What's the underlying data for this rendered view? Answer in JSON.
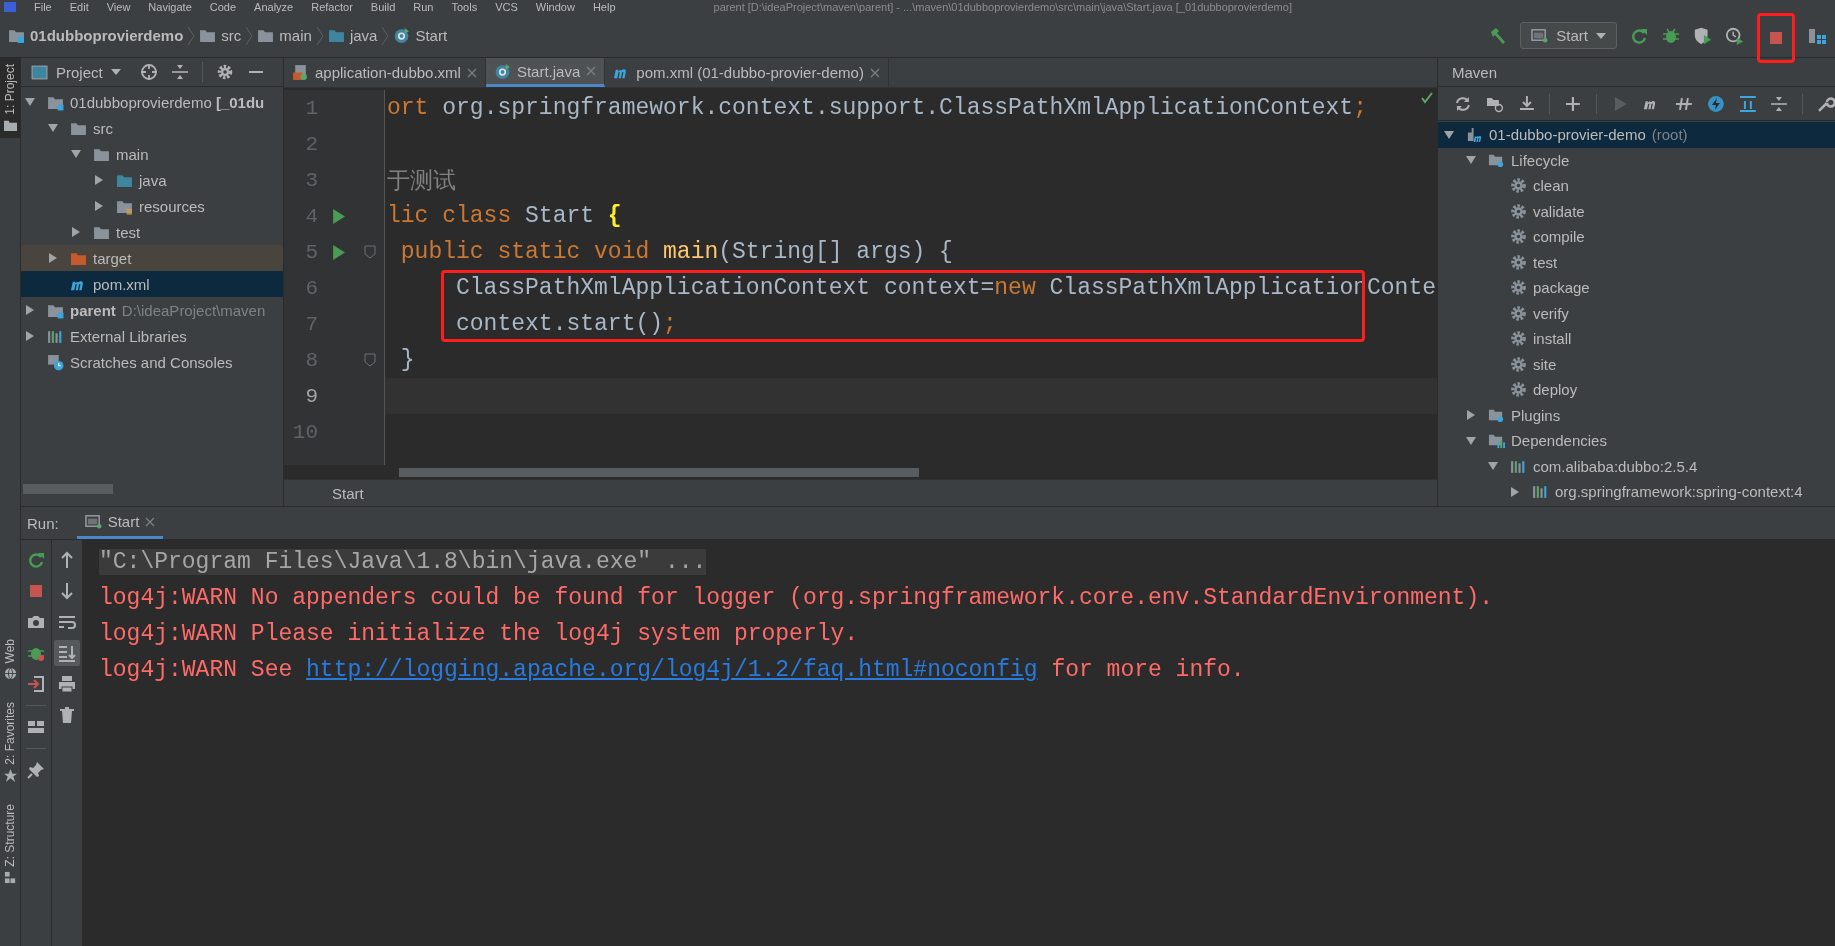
{
  "menu": [
    "File",
    "Edit",
    "View",
    "Navigate",
    "Code",
    "Analyze",
    "Refactor",
    "Build",
    "Run",
    "Tools",
    "VCS",
    "Window",
    "Help"
  ],
  "window_title": "parent [D:\\ideaProject\\maven\\parent] - ...\\maven\\01dubboprovierdemo\\src\\main\\java\\Start.java [_01dubboprovierdemo]",
  "breadcrumbs": [
    {
      "label": "01dubboprovierdemo",
      "kind": "module"
    },
    {
      "label": "src",
      "kind": "folder"
    },
    {
      "label": "main",
      "kind": "folder"
    },
    {
      "label": "java",
      "kind": "source-folder"
    },
    {
      "label": "Start",
      "kind": "class"
    }
  ],
  "run_config": {
    "label": "Start"
  },
  "stop_highlighted": true,
  "tool_strip": {
    "top": [
      {
        "label": "1: Project",
        "selected": true
      }
    ],
    "bottom": [
      {
        "label": "Web",
        "kind": "web",
        "selected": false
      },
      {
        "label": "2: Favorites",
        "kind": "favorites",
        "selected": false
      },
      {
        "label": "Z: Structure",
        "kind": "structure",
        "selected": false
      }
    ]
  },
  "project": {
    "title": "Project",
    "tree": [
      {
        "label": "01dubboprovierdemo **[_01du**",
        "kind": "module",
        "expanded": true,
        "selected": false,
        "children": [
          {
            "label": "src",
            "kind": "folder",
            "expanded": true,
            "selected": false,
            "children": [
              {
                "label": "main",
                "kind": "folder",
                "expanded": true,
                "selected": false,
                "children": [
                  {
                    "label": "java",
                    "kind": "source-folder",
                    "expanded": false,
                    "selected": false
                  },
                  {
                    "label": "resources",
                    "kind": "resource-folder",
                    "expanded": false,
                    "selected": false
                  }
                ]
              },
              {
                "label": "test",
                "kind": "folder",
                "expanded": false,
                "selected": false
              }
            ]
          },
          {
            "label": "target",
            "kind": "excluded-folder",
            "expanded": false,
            "selected": false
          },
          {
            "label": "pom.xml",
            "kind": "maven-file",
            "selected": true
          }
        ]
      },
      {
        "label": "parent",
        "bold": true,
        "note": "D:\\ideaProject\\maven",
        "kind": "module",
        "expanded": false,
        "selected": false
      },
      {
        "label": "External Libraries",
        "kind": "libraries",
        "expanded": false,
        "selected": false
      },
      {
        "label": "Scratches and Consoles",
        "kind": "scratches",
        "selected": false
      }
    ]
  },
  "editor": {
    "tabs": [
      {
        "label": "application-dubbo.xml",
        "kind": "xml",
        "selected": false
      },
      {
        "label": "Start.java",
        "kind": "class",
        "selected": true
      },
      {
        "label": "pom.xml (01-dubbo-provier-demo)",
        "kind": "maven",
        "selected": false
      }
    ],
    "lines": [
      {
        "number": "1",
        "run_marker": false,
        "fold_marker": false,
        "highlighted": false,
        "current": false,
        "segments": [
          {
            "text": "ort",
            "kind": "keyword"
          },
          {
            "text": " org.springframework.context.support.ClassPathXmlApplicationContext",
            "kind": "plain"
          },
          {
            "text": ";",
            "kind": "keyword"
          }
        ]
      },
      {
        "number": "2",
        "run_marker": false,
        "fold_marker": false,
        "highlighted": false,
        "current": false
      },
      {
        "number": "3",
        "run_marker": false,
        "fold_marker": false,
        "highlighted": false,
        "current": false,
        "segments": [
          {
            "text": "于测试",
            "kind": "comment"
          }
        ]
      },
      {
        "number": "4",
        "run_marker": true,
        "fold_marker": false,
        "highlighted": false,
        "current": false,
        "segments": [
          {
            "text": "lic class",
            "kind": "keyword"
          },
          {
            "text": " Start ",
            "kind": "plain"
          },
          {
            "text": "{",
            "kind": "brace"
          }
        ]
      },
      {
        "number": "5",
        "run_marker": true,
        "fold_marker": true,
        "highlighted": false,
        "current": false,
        "segments": [
          {
            "text": " public static void ",
            "kind": "keyword"
          },
          {
            "text": "main",
            "kind": "method"
          },
          {
            "text": "(String[] args) {",
            "kind": "plain"
          }
        ]
      },
      {
        "number": "6",
        "run_marker": false,
        "fold_marker": false,
        "highlighted": true,
        "current": false,
        "segments": [
          {
            "text": "     ClassPathXmlApplicationContext context=",
            "kind": "plain"
          },
          {
            "text": "new",
            "kind": "keyword"
          },
          {
            "text": " ClassPathXmlApplicationConte",
            "kind": "plain"
          }
        ]
      },
      {
        "number": "7",
        "run_marker": false,
        "fold_marker": false,
        "highlighted": true,
        "current": false,
        "segments": [
          {
            "text": "     context.start()",
            "kind": "plain"
          },
          {
            "text": ";",
            "kind": "keyword"
          }
        ]
      },
      {
        "number": "8",
        "run_marker": false,
        "fold_marker": true,
        "highlighted": false,
        "current": false,
        "segments": [
          {
            "text": " }",
            "kind": "plain"
          }
        ]
      },
      {
        "number": "9",
        "run_marker": false,
        "fold_marker": false,
        "highlighted": false,
        "current": true
      },
      {
        "number": "10",
        "run_marker": false,
        "fold_marker": false,
        "highlighted": false,
        "current": false
      }
    ],
    "breadcrumb": "Start"
  },
  "maven": {
    "title": "Maven",
    "tree": [
      {
        "label": "01-dubbo-provier-demo",
        "note": "(root)",
        "kind": "project",
        "expanded": true,
        "selected": true,
        "children": [
          {
            "label": "Lifecycle",
            "kind": "lifecycle",
            "expanded": true,
            "selected": false,
            "children": [
              {
                "label": "clean",
                "kind": "goal",
                "selected": false
              },
              {
                "label": "validate",
                "kind": "goal",
                "selected": false
              },
              {
                "label": "compile",
                "kind": "goal",
                "selected": false
              },
              {
                "label": "test",
                "kind": "goal",
                "selected": false
              },
              {
                "label": "package",
                "kind": "goal",
                "selected": false
              },
              {
                "label": "verify",
                "kind": "goal",
                "selected": false
              },
              {
                "label": "install",
                "kind": "goal",
                "selected": false
              },
              {
                "label": "site",
                "kind": "goal",
                "selected": false
              },
              {
                "label": "deploy",
                "kind": "goal",
                "selected": false
              }
            ]
          },
          {
            "label": "Plugins",
            "kind": "lifecycle",
            "expanded": false,
            "selected": false
          },
          {
            "label": "Dependencies",
            "kind": "dependencies",
            "expanded": true,
            "selected": false,
            "children": [
              {
                "label": "com.alibaba:dubbo:2.5.4",
                "kind": "dependency",
                "expanded": true,
                "selected": false,
                "children": [
                  {
                    "label": "org.springframework:spring-context:4",
                    "kind": "dependency",
                    "expanded": false,
                    "selected": false
                  }
                ]
              }
            ]
          }
        ]
      }
    ]
  },
  "run": {
    "label": "Run:",
    "tabs": [
      {
        "label": "Start",
        "selected": true
      }
    ],
    "scroll_to_end": true,
    "console": [
      {
        "segments": [
          {
            "text": "\"C:\\Program Files\\Java\\1.8\\bin\\java.exe\" ...",
            "kind": "command"
          }
        ]
      },
      {
        "segments": [
          {
            "text": "log4j:WARN No appenders could be found for logger (org.springframework.core.env.StandardEnvironment).",
            "kind": "error"
          }
        ]
      },
      {
        "segments": [
          {
            "text": "log4j:WARN Please initialize the log4j system properly.",
            "kind": "error"
          }
        ]
      },
      {
        "segments": [
          {
            "text": "log4j:WARN See ",
            "kind": "error"
          },
          {
            "text": "http://logging.apache.org/log4j/1.2/faq.html#noconfig",
            "kind": "link"
          },
          {
            "text": " for more info.",
            "kind": "error"
          }
        ]
      }
    ]
  }
}
